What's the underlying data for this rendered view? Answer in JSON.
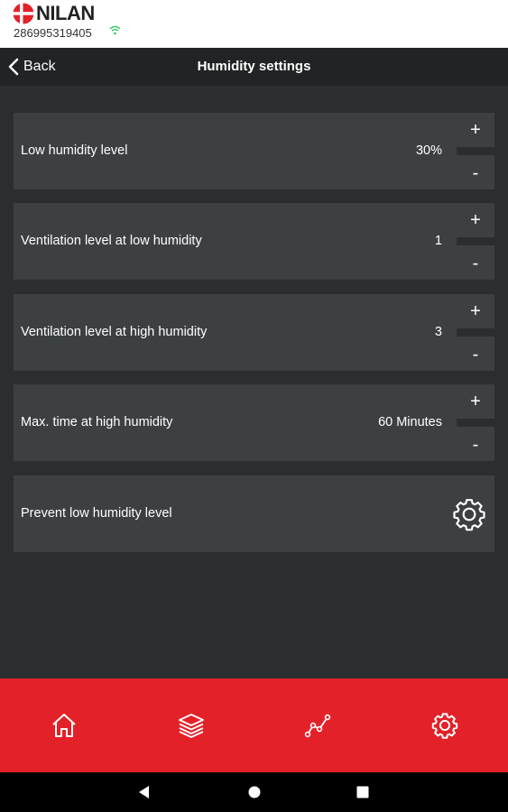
{
  "brand": {
    "name": "NILAN",
    "device_id": "286995319405",
    "accent_color": "#e32129",
    "wifi_color": "#3cc36b"
  },
  "header": {
    "back_label": "Back",
    "title": "Humidity settings"
  },
  "settings": [
    {
      "label": "Low humidity level",
      "value": "30%",
      "plus": "+",
      "minus": "-"
    },
    {
      "label": "Ventilation level at low humidity",
      "value": "1",
      "plus": "+",
      "minus": "-"
    },
    {
      "label": "Ventilation level at high humidity",
      "value": "3",
      "plus": "+",
      "minus": "-"
    },
    {
      "label": "Max. time at high humidity",
      "value": "60 Minutes",
      "plus": "+",
      "minus": "-"
    },
    {
      "label": "Prevent low humidity level",
      "icon": "gear-icon"
    }
  ],
  "bottom_nav": {
    "items": [
      "home-icon",
      "layers-icon",
      "graph-icon",
      "settings-icon"
    ]
  },
  "system_nav": {
    "items": [
      "back-triangle-icon",
      "home-circle-icon",
      "recents-square-icon"
    ]
  }
}
